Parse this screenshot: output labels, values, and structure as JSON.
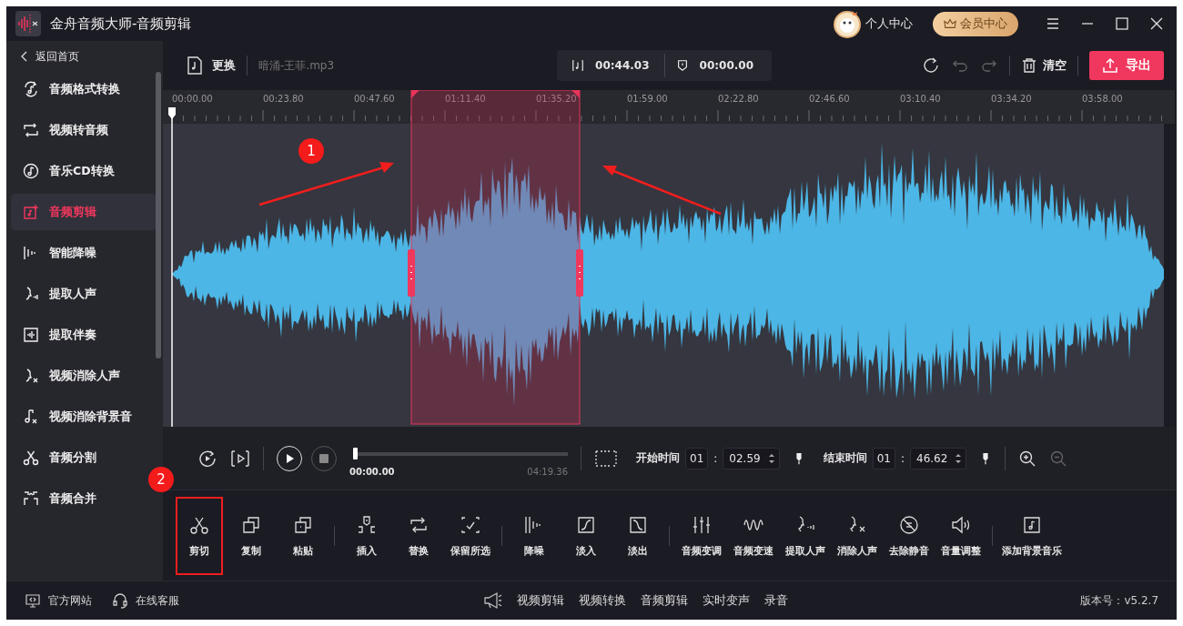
{
  "window": {
    "title": "金舟音频大师-音频剪辑"
  },
  "header": {
    "user": "个人中心",
    "vip": "会员中心"
  },
  "sidebar": {
    "back": "返回首页",
    "items": [
      {
        "label": "音频格式转换",
        "selected": false
      },
      {
        "label": "视频转音频",
        "selected": false
      },
      {
        "label": "音乐CD转换",
        "selected": false
      },
      {
        "label": "音频剪辑",
        "selected": true
      },
      {
        "label": "智能降噪",
        "selected": false
      },
      {
        "label": "提取人声",
        "selected": false
      },
      {
        "label": "提取伴奏",
        "selected": false
      },
      {
        "label": "视频消除人声",
        "selected": false
      },
      {
        "label": "视频消除背景音",
        "selected": false
      },
      {
        "label": "音频分割",
        "selected": false
      },
      {
        "label": "音频合并",
        "selected": false
      }
    ]
  },
  "file_bar": {
    "replace": "更换",
    "file": "暗涌-王菲.mp3",
    "selection_duration": "00:44.03",
    "cursor_time": "00:00.00",
    "undo_disabled": true,
    "redo_disabled": true,
    "clear": "清空",
    "export": "导出"
  },
  "timeline": {
    "ticks": [
      "00:00.00",
      "00:23.80",
      "00:47.60",
      "01:11.40",
      "01:35.20",
      "01:59.00",
      "02:22.80",
      "02:46.60",
      "03:10.40",
      "03:34.20",
      "03:58.00"
    ]
  },
  "player": {
    "level": 0,
    "current": "00:00.00",
    "total": "04:19.36",
    "zoom_out_disabled": true,
    "start": {
      "label": "开始时间",
      "minutes": "01",
      "separator": ":",
      "seconds": "02.59"
    },
    "end": {
      "label": "结束时间",
      "minutes": "01",
      "separator": ":",
      "seconds": "46.62"
    }
  },
  "tool_groups": [
    [
      {
        "label": "剪切",
        "highlighted": true
      },
      {
        "label": "复制",
        "highlighted": false
      },
      {
        "label": "粘贴",
        "highlighted": false
      }
    ],
    [
      {
        "label": "插入",
        "highlighted": false
      },
      {
        "label": "替换",
        "highlighted": false
      },
      {
        "label": "保留所选",
        "highlighted": false
      }
    ],
    [
      {
        "label": "降噪",
        "highlighted": false
      },
      {
        "label": "淡入",
        "highlighted": false
      },
      {
        "label": "淡出",
        "highlighted": false
      }
    ],
    [
      {
        "label": "音频变调",
        "highlighted": false
      },
      {
        "label": "音频变速",
        "highlighted": false
      },
      {
        "label": "提取人声",
        "highlighted": false
      },
      {
        "label": "消除人声",
        "highlighted": false
      },
      {
        "label": "去除静音",
        "highlighted": false
      },
      {
        "label": "音量调整",
        "highlighted": false
      }
    ],
    [
      {
        "label": "添加背景音乐",
        "highlighted": false
      }
    ]
  ],
  "footer": {
    "links": [
      "官方网站",
      "在线客服"
    ],
    "shortcuts": [
      "视频剪辑",
      "视频转换",
      "音频剪辑",
      "实时变声",
      "录音"
    ],
    "version": "版本号：v5.2.7"
  },
  "annotations": [
    "1",
    "2"
  ]
}
